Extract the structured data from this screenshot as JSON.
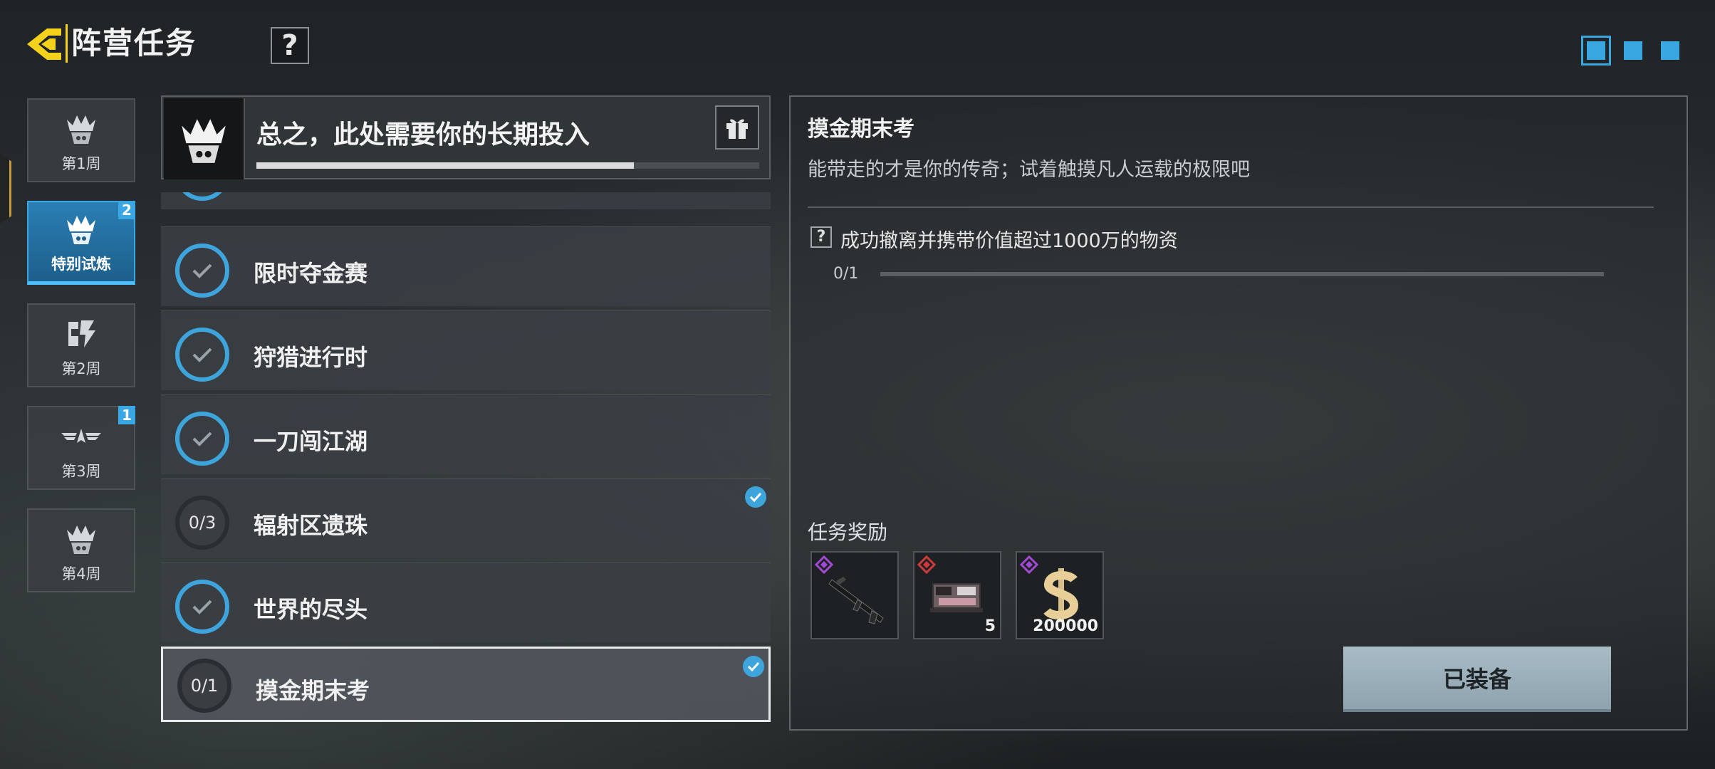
{
  "header": {
    "title": "阵营任务",
    "help_label": "?"
  },
  "page_dots": {
    "count": 3,
    "active_index": 0
  },
  "tabs": [
    {
      "label": "第1周",
      "badge": "",
      "active": false,
      "icon": "crown-emblem-icon"
    },
    {
      "label": "特别试炼",
      "badge": "2",
      "active": true,
      "icon": "crown-emblem-icon"
    },
    {
      "label": "第2周",
      "badge": "",
      "active": false,
      "icon": "calligraphy-emblem-icon"
    },
    {
      "label": "第3周",
      "badge": "1",
      "active": false,
      "icon": "winged-emblem-icon"
    },
    {
      "label": "第4周",
      "badge": "",
      "active": false,
      "icon": "crown-emblem-icon"
    }
  ],
  "list_header": {
    "title": "总之，此处需要你的长期投入",
    "progress": 0.75,
    "gift_icon": "gift-icon"
  },
  "quests": [
    {
      "name": "限时夺金赛",
      "status": "done",
      "progress": "",
      "tracked": false
    },
    {
      "name": "狩猎进行时",
      "status": "done",
      "progress": "",
      "tracked": false
    },
    {
      "name": "一刀闯江湖",
      "status": "done",
      "progress": "",
      "tracked": false
    },
    {
      "name": "辐射区遗珠",
      "status": "todo",
      "progress": "0/3",
      "tracked": true
    },
    {
      "name": "世界的尽头",
      "status": "done",
      "progress": "",
      "tracked": false
    },
    {
      "name": "摸金期末考",
      "status": "todo",
      "progress": "0/1",
      "tracked": true,
      "selected": true
    }
  ],
  "detail": {
    "title": "摸金期末考",
    "description": "能带走的才是你的传奇；试着触摸凡人运载的极限吧",
    "objective_help": "?",
    "objective": "成功撤离并携带价值超过1000万的物资",
    "objective_progress": "0/1",
    "reward_label": "任务奖励",
    "rewards": [
      {
        "name": "rifle",
        "count": "",
        "rarity_color": "#a24ad6"
      },
      {
        "name": "ammo-crate",
        "count": "5",
        "rarity_color": "#d03a3a"
      },
      {
        "name": "currency",
        "count": "200000",
        "rarity_color": "#a24ad6"
      }
    ],
    "action_label": "已装备"
  },
  "colors": {
    "accent_blue": "#3ea4dc",
    "back_yellow": "#f4d21c"
  }
}
